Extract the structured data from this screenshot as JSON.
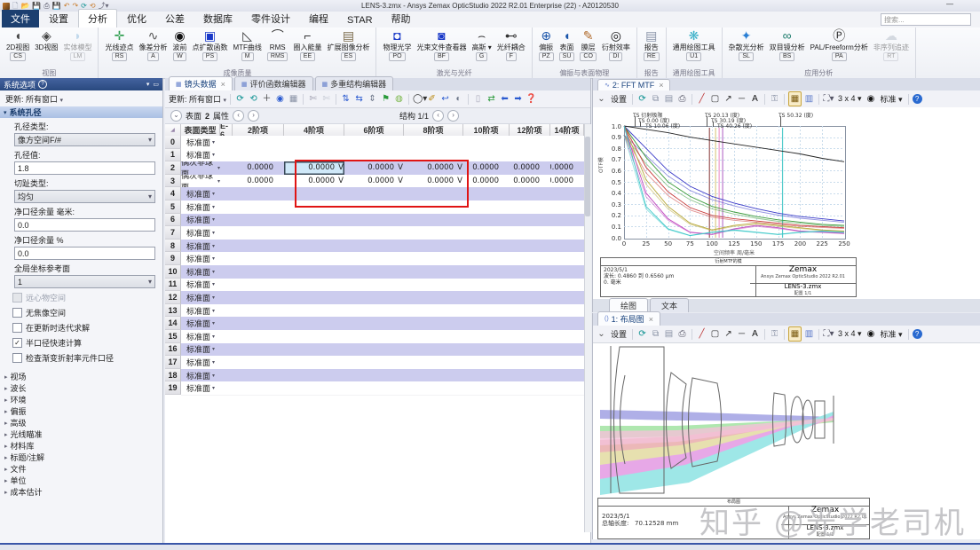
{
  "window": {
    "title": "LENS-3.zmx - Ansys Zemax OpticStudio 2022 R2.01   Enterprise (22) - A20120530",
    "minimize_glyph": "—",
    "search_placeholder": "搜索..."
  },
  "menu_tabs": [
    {
      "label": "文件",
      "style": "file"
    },
    {
      "label": "设置"
    },
    {
      "label": "分析",
      "active": true
    },
    {
      "label": "优化"
    },
    {
      "label": "公差"
    },
    {
      "label": "数据库"
    },
    {
      "label": "零件设计"
    },
    {
      "label": "编程"
    },
    {
      "label": "STAR"
    },
    {
      "label": "帮助"
    }
  ],
  "ribbon_groups": [
    {
      "name": "视图",
      "items": [
        {
          "label": "2D视图",
          "key": "CS",
          "icon": "lens-2d-icon",
          "glyph": "◖",
          "color": "#444"
        },
        {
          "label": "3D视图",
          "key": "",
          "icon": "lens-3d-icon",
          "glyph": "◈",
          "color": "#444"
        },
        {
          "label": "实体模型",
          "key": "LM",
          "icon": "solid-model-icon",
          "glyph": "◗",
          "color": "#7fb2d9",
          "disabled": true
        }
      ]
    },
    {
      "name": "成像质量",
      "items": [
        {
          "label": "光线迹点",
          "key": "RS",
          "icon": "rays-spots-icon",
          "glyph": "✛",
          "color": "#2e9e4f"
        },
        {
          "label": "像差分析",
          "key": "A",
          "icon": "aberration-icon",
          "glyph": "∿",
          "color": "#555"
        },
        {
          "label": "波前",
          "key": "W",
          "icon": "wavefront-icon",
          "glyph": "◉",
          "color": "#111"
        },
        {
          "label": "点扩散函数",
          "key": "PS",
          "icon": "psf-icon",
          "glyph": "▣",
          "color": "#1838c8"
        },
        {
          "label": "MTF曲线",
          "key": "M",
          "icon": "mtf-curve-icon",
          "glyph": "◺",
          "color": "#333"
        },
        {
          "label": "RMS",
          "key": "RMS",
          "icon": "rms-icon",
          "glyph": "⌒",
          "color": "#333"
        },
        {
          "label": "圈入能量",
          "key": "EE",
          "icon": "encircled-energy-icon",
          "glyph": "⌐",
          "color": "#333"
        },
        {
          "label": "扩展图像分析",
          "key": "ES",
          "icon": "extended-image-icon",
          "glyph": "▤",
          "color": "#7a6a4a"
        }
      ]
    },
    {
      "name": "激光与光纤",
      "items": [
        {
          "label": "物理光学",
          "key": "PO",
          "icon": "physical-optics-icon",
          "glyph": "◘",
          "color": "#1838c8"
        },
        {
          "label": "光束文件查看器",
          "key": "BF",
          "icon": "beam-file-viewer-icon",
          "glyph": "◙",
          "color": "#1838c8"
        },
        {
          "label": "高斯",
          "key": "G",
          "icon": "gaussian-icon",
          "glyph": "⌢",
          "color": "#333",
          "caret": true
        },
        {
          "label": "光纤耦合",
          "key": "F",
          "icon": "fiber-coupling-icon",
          "glyph": "⊷",
          "color": "#333"
        }
      ]
    },
    {
      "name": "偏振与表面物理",
      "items": [
        {
          "label": "偏振",
          "key": "PZ",
          "icon": "polarization-icon",
          "glyph": "⊕",
          "color": "#1a55aa"
        },
        {
          "label": "表面",
          "key": "SU",
          "icon": "surface-icon",
          "glyph": "◖",
          "color": "#1a55aa"
        },
        {
          "label": "膜层",
          "key": "CO",
          "icon": "coatings-icon",
          "glyph": "✎",
          "color": "#b06a2a"
        },
        {
          "label": "衍射效率",
          "key": "DI",
          "icon": "diffraction-efficiency-icon",
          "glyph": "◎",
          "color": "#111"
        }
      ]
    },
    {
      "name": "报告",
      "items": [
        {
          "label": "报告",
          "key": "RE",
          "icon": "reports-icon",
          "glyph": "▤",
          "color": "#8a94a8"
        }
      ]
    },
    {
      "name": "通用绘图工具",
      "items": [
        {
          "label": "通用绘图工具",
          "key": "U1",
          "icon": "universal-plot-icon",
          "glyph": "❋",
          "color": "#3ab0c8"
        }
      ]
    },
    {
      "name": "应用分析",
      "items": [
        {
          "label": "杂散光分析",
          "key": "SL",
          "icon": "stray-light-icon",
          "glyph": "✦",
          "color": "#2a7fd4"
        },
        {
          "label": "双目镜分析",
          "key": "BS",
          "icon": "binocular-icon",
          "glyph": "∞",
          "color": "#1a7a6a"
        },
        {
          "label": "PAL/Freeform分析",
          "key": "PA",
          "icon": "pal-freeform-icon",
          "glyph": "Ⓟ",
          "color": "#333"
        },
        {
          "label": "非序列追迹",
          "key": "RT",
          "icon": "nsc-trace-icon",
          "glyph": "☁",
          "color": "#aab4c0",
          "disabled": true
        }
      ]
    }
  ],
  "sidebar": {
    "title": "系统选项",
    "help_glyph": "?",
    "collapse_glyph": "▾",
    "pin_glyph": "▭",
    "update_label": "更新: 所有窗口",
    "section": "系统孔径",
    "fields": [
      {
        "label": "孔径类型:",
        "value": "像方空间F/#",
        "kind": "select"
      },
      {
        "label": "孔径值:",
        "value": "1.8",
        "kind": "input"
      },
      {
        "label": "切趾类型:",
        "value": "均匀",
        "kind": "select"
      },
      {
        "label": "净口径余量 毫米:",
        "value": "0.0",
        "kind": "input"
      },
      {
        "label": "净口径余量 %",
        "value": "0.0",
        "kind": "input"
      },
      {
        "label": "全局坐标参考面",
        "value": "1",
        "kind": "select"
      }
    ],
    "checkboxes": [
      {
        "label": "远心物空间",
        "checked": false,
        "disabled": true
      },
      {
        "label": "无焦像空间",
        "checked": false
      },
      {
        "label": "在更新时迭代求解",
        "checked": false
      },
      {
        "label": "半口径快速计算",
        "checked": true
      },
      {
        "label": "检查渐变折射率元件口径",
        "checked": false
      }
    ],
    "tree": [
      "视场",
      "波长",
      "环境",
      "偏振",
      "高级",
      "光线瞄准",
      "材料库",
      "标题/注解",
      "文件",
      "单位",
      "成本估计"
    ]
  },
  "editor": {
    "tabs": [
      {
        "label": "镜头数据",
        "close": "×",
        "active": true
      },
      {
        "label": "评价函数编辑器"
      },
      {
        "label": "多重结构编辑器"
      }
    ],
    "update_label": "更新: 所有窗口",
    "surface_row": {
      "prefix": "表面",
      "number": "2",
      "suffix": "属性"
    },
    "config_label": "结构 1/1",
    "toolbar_icons": [
      {
        "name": "refresh-icon",
        "g": "⟳",
        "c": "#0a9090"
      },
      {
        "name": "refresh-all-icon",
        "g": "⟲",
        "c": "#0a9090"
      },
      {
        "name": "insert-surface-icon",
        "g": "＋",
        "c": "#333"
      },
      {
        "name": "globe-icon",
        "g": "◉",
        "c": "#2a5ad0"
      },
      {
        "name": "spreadsheet-icon",
        "g": "▦",
        "c": "#8a93a6"
      },
      {
        "sep": true
      },
      {
        "name": "cut-icon",
        "g": "✄",
        "c": "#99a"
      },
      {
        "name": "cut-alt-icon",
        "g": "✄",
        "c": "#c3c8d2"
      },
      {
        "sep": true
      },
      {
        "name": "move-vertical-icon",
        "g": "⇅",
        "c": "#2a5ad0"
      },
      {
        "name": "move-horizontal-icon",
        "g": "⇆",
        "c": "#2a5ad0"
      },
      {
        "name": "move-both-icon",
        "g": "⇕",
        "c": "#6a7386"
      },
      {
        "name": "flag-icon",
        "g": "⚑",
        "c": "#2a9a3a"
      },
      {
        "name": "leaf-icon",
        "g": "◍",
        "c": "#79b648"
      },
      {
        "sep": true
      },
      {
        "name": "aperture-menu-icon",
        "g": "◯",
        "c": "#333",
        "caret": true
      },
      {
        "name": "pen-icon",
        "g": "✐",
        "c": "#b8860b"
      },
      {
        "name": "undo-curve-icon",
        "g": "↩",
        "c": "#2a5ad0"
      },
      {
        "name": "contrast-icon",
        "g": "◐",
        "c": "#6a7386"
      },
      {
        "sep": true
      },
      {
        "name": "panel-icon",
        "g": "▯",
        "c": "#aab"
      },
      {
        "name": "sync-icon",
        "g": "⇄",
        "c": "#2a9a3a"
      },
      {
        "name": "jump-left-icon",
        "g": "⬅",
        "c": "#2a5ad0"
      },
      {
        "name": "jump-right-icon",
        "g": "➡",
        "c": "#2a5ad0"
      },
      {
        "name": "help-icon",
        "g": "❓",
        "c": "#2a5ad0"
      }
    ],
    "table": {
      "corner_glyph": "◢",
      "col_headers": [
        "表面类型",
        "E-6",
        "2阶项",
        "4阶项",
        "6阶项",
        "8阶项",
        "10阶项",
        "12阶项",
        "14阶项"
      ],
      "rows": [
        {
          "n": "0",
          "type": "标准面"
        },
        {
          "n": "1",
          "type": "标准面"
        },
        {
          "n": "2",
          "type": "偶次非球面",
          "values": [
            "0.0000",
            "0.0000 V",
            "0.0000 V",
            "0.0000 V",
            "0.0000",
            "0.0000",
            "0.0000"
          ],
          "selected_col": 1
        },
        {
          "n": "3",
          "type": "偶次非球面",
          "values": [
            "0.0000",
            "0.0000 V",
            "0.0000 V",
            "0.0000 V",
            "0.0000",
            "0.0000",
            "0.0000"
          ]
        },
        {
          "n": "4",
          "type": "标准面"
        },
        {
          "n": "5",
          "type": "标准面"
        },
        {
          "n": "6",
          "type": "标准面"
        },
        {
          "n": "7",
          "type": "标准面"
        },
        {
          "n": "8",
          "type": "标准面"
        },
        {
          "n": "9",
          "type": "标准面"
        },
        {
          "n": "10",
          "type": "标准面"
        },
        {
          "n": "11",
          "type": "标准面"
        },
        {
          "n": "12",
          "type": "标准面"
        },
        {
          "n": "13",
          "type": "标准面"
        },
        {
          "n": "14",
          "type": "标准面"
        },
        {
          "n": "15",
          "type": "标准面"
        },
        {
          "n": "16",
          "type": "标准面"
        },
        {
          "n": "17",
          "type": "标准面"
        },
        {
          "n": "18",
          "type": "标准面"
        },
        {
          "n": "19",
          "type": "标准面"
        }
      ]
    }
  },
  "panel_labels": {
    "settings": "设置",
    "grid_label": "3 x 4",
    "standard_label": "标准"
  },
  "panel_toolbar": [
    {
      "name": "collapse-chevron-icon",
      "g": "⌄",
      "c": "#555"
    },
    {
      "label_key": "settings"
    },
    {
      "sep": true
    },
    {
      "name": "refresh-icon",
      "g": "⟳",
      "c": "#0a9090"
    },
    {
      "name": "clone-icon",
      "g": "⧉",
      "c": "#8a93a6"
    },
    {
      "name": "save-icon",
      "g": "▤",
      "c": "#8a93a6"
    },
    {
      "name": "print-icon",
      "g": "⎙",
      "c": "#556"
    },
    {
      "sep": true
    },
    {
      "name": "line-tool-icon",
      "g": "╱",
      "c": "#b33"
    },
    {
      "name": "rect-tool-icon",
      "g": "▢",
      "c": "#333"
    },
    {
      "name": "arrow-tool-icon",
      "g": "↗",
      "c": "#333"
    },
    {
      "name": "dash-tool-icon",
      "g": "─",
      "c": "#333"
    },
    {
      "name": "text-tool-icon",
      "g": "A",
      "c": "#111"
    },
    {
      "sep": true
    },
    {
      "name": "lock-icon",
      "g": "⚿",
      "c": "#8a93a6"
    },
    {
      "sep": true
    },
    {
      "name": "grid-toggle-icon",
      "g": "▦",
      "c": "#7a5a10",
      "hl": true
    },
    {
      "name": "layers-icon",
      "g": "▥",
      "c": "#5a78c8"
    },
    {
      "sep": true
    },
    {
      "name": "camera-icon",
      "g": "⛶",
      "c": "#556",
      "caret": true
    },
    {
      "label_key": "grid_label",
      "caret": true
    },
    {
      "name": "record-icon",
      "g": "◉",
      "c": "#111"
    },
    {
      "label_key": "standard_label",
      "caret": true
    },
    {
      "sep": true
    },
    {
      "name": "help-icon",
      "g": "?",
      "badge": true
    }
  ],
  "mtf_panel": {
    "tab": "2: FFT MTF",
    "tab_close": "×",
    "footer": {
      "title": "衍射MTF的模",
      "date": "2023/5/1",
      "line2": "波长: 0.4860 到 0.6560 μm",
      "line3": "0. 毫米",
      "brand": "Zemax",
      "brand_sub": "Ansys Zemax OpticStudio 2022 R2.01",
      "file": "LENS-3.zmx",
      "config": "配置 1/1"
    },
    "bottom_tabs": [
      {
        "label": "绘图",
        "active": true
      },
      {
        "label": "文本"
      }
    ]
  },
  "layout_panel": {
    "tab": "1: 布局图",
    "tab_close": "×",
    "footer": {
      "title": "布局图",
      "date": "2023/5/1",
      "length_label": "总轴长度:",
      "length_value": "70.12528 mm",
      "brand": "Zemax",
      "brand_sub": "Ansys Zemax OpticStudio 2022 R2.01",
      "file": "LENS-3.zmx",
      "config": "配置 1/1"
    }
  },
  "watermark": "知乎 @光学老司机",
  "chart_data": {
    "type": "line",
    "title": "FFT MTF",
    "xlabel": "空间频率 周/毫米",
    "ylabel": "OTF模",
    "xlim": [
      0,
      250
    ],
    "ylim": [
      0.0,
      1.0
    ],
    "xticks": [
      0,
      25,
      50,
      75,
      100,
      125,
      150,
      175,
      200,
      225,
      250
    ],
    "yticks": [
      0.0,
      0.1,
      0.2,
      0.3,
      0.4,
      0.5,
      0.6,
      0.7,
      0.8,
      0.9,
      1.0
    ],
    "grid": true,
    "legend_position": "top",
    "x": [
      0,
      25,
      50,
      75,
      100,
      125,
      150,
      175,
      200,
      225,
      250
    ],
    "series": [
      {
        "name": "TS 衍射极限",
        "color": "#222222",
        "values": [
          1.0,
          0.97,
          0.94,
          0.9,
          0.87,
          0.84,
          0.81,
          0.78,
          0.75,
          0.71,
          0.68
        ]
      },
      {
        "name": "TS 0.00 (度)",
        "color": "#3a3ac8",
        "values": [
          1.0,
          0.8,
          0.6,
          0.46,
          0.37,
          0.31,
          0.26,
          0.22,
          0.19,
          0.17,
          0.15
        ]
      },
      {
        "name": "TS 10.06 (度)",
        "color": "#3a9a3a",
        "values": [
          1.0,
          0.72,
          0.5,
          0.37,
          0.28,
          0.23,
          0.19,
          0.16,
          0.14,
          0.12,
          0.11
        ]
      },
      {
        "name": "TS 20.13 (度)",
        "color": "#c83a3a",
        "values": [
          1.0,
          0.63,
          0.41,
          0.27,
          0.2,
          0.17,
          0.15,
          0.13,
          0.11,
          0.1,
          0.09
        ]
      },
      {
        "name": "TS 30.19 (度)",
        "color": "#b8a83a",
        "values": [
          1.0,
          0.52,
          0.28,
          0.13,
          0.07,
          0.11,
          0.13,
          0.11,
          0.09,
          0.07,
          0.06
        ]
      },
      {
        "name": "TS 40.26 (度)",
        "color": "#c04ac0",
        "values": [
          1.0,
          0.4,
          0.17,
          0.05,
          0.03,
          0.08,
          0.11,
          0.09,
          0.06,
          0.05,
          0.04
        ]
      },
      {
        "name": "TS 50.32 (度)",
        "color": "#3ac8c8",
        "values": [
          1.0,
          0.28,
          0.08,
          0.02,
          0.05,
          0.07,
          0.05,
          0.03,
          0.05,
          0.06,
          0.05
        ]
      }
    ],
    "vlines": [
      {
        "x": 97,
        "color": "#995555"
      },
      {
        "x": 104,
        "color": "#ddcc88"
      },
      {
        "x": 108,
        "color": "#ee99cc"
      },
      {
        "x": 112,
        "color": "#bb77cc"
      },
      {
        "x": 180,
        "color": "#55cccc"
      }
    ]
  }
}
